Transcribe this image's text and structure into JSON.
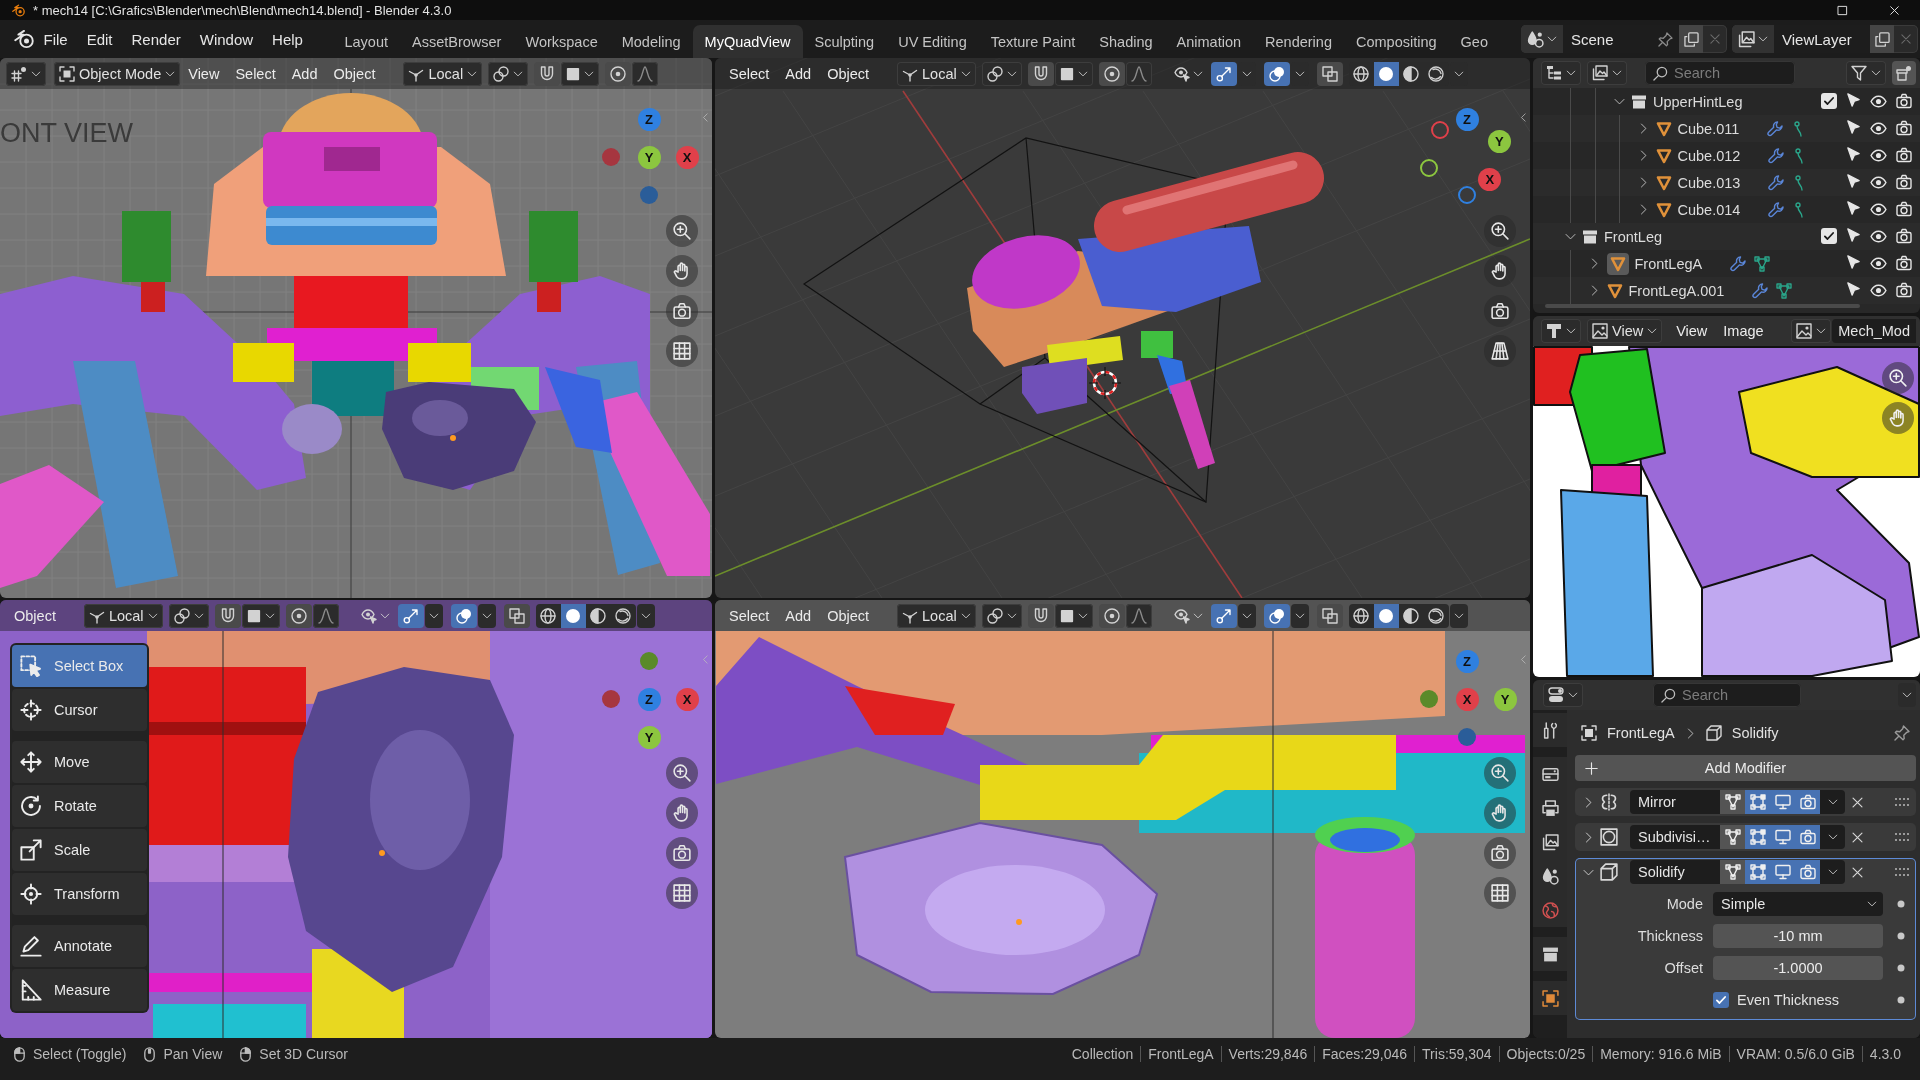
{
  "window": {
    "title": "* mech14 [C:\\Grafics\\Blender\\mech\\Blend\\mech14.blend] - Blender 4.3.0"
  },
  "menu_bar": {
    "menus": [
      "File",
      "Edit",
      "Render",
      "Window",
      "Help"
    ],
    "workspaces": [
      {
        "label": "Layout",
        "selected": false
      },
      {
        "label": "AssetBrowser",
        "selected": false
      },
      {
        "label": "Workspace",
        "selected": false
      },
      {
        "label": "Modeling",
        "selected": false
      },
      {
        "label": "MyQuadView",
        "selected": true
      },
      {
        "label": "Sculpting",
        "selected": false
      },
      {
        "label": "UV Editing",
        "selected": false
      },
      {
        "label": "Texture Paint",
        "selected": false
      },
      {
        "label": "Shading",
        "selected": false
      },
      {
        "label": "Animation",
        "selected": false
      },
      {
        "label": "Rendering",
        "selected": false
      },
      {
        "label": "Compositing",
        "selected": false
      },
      {
        "label": "Geo",
        "selected": false
      }
    ],
    "scene": "Scene",
    "view_layer": "ViewLayer"
  },
  "viewports": [
    {
      "header": [
        {
          "kind": "editor_type"
        },
        {
          "kind": "mode",
          "label": "Object Mode"
        },
        {
          "kind": "menu",
          "label": "View"
        },
        {
          "kind": "menu",
          "label": "Select"
        },
        {
          "kind": "menu",
          "label": "Add"
        },
        {
          "kind": "menu",
          "label": "Object"
        },
        {
          "kind": "orientation",
          "label": "Local"
        },
        {
          "kind": "pivot"
        },
        {
          "kind": "snap",
          "on": false
        },
        {
          "kind": "snap_target"
        },
        {
          "kind": "proportional",
          "on": false
        },
        {
          "kind": "falloff"
        }
      ],
      "overlay_text": "ONT VIEW",
      "perspective": false,
      "gizmo": [
        {
          "kind": "ball",
          "color": "#a6363f"
        },
        {
          "kind": "ball",
          "color": "#2a5d99"
        },
        {
          "kind": "ball",
          "label": "Z",
          "color": "#2f80e0"
        },
        {
          "kind": "ball",
          "label": "X",
          "color": "#e0404a"
        },
        {
          "kind": "ball",
          "label": "Y",
          "color": "#8cc63f"
        }
      ]
    },
    {
      "header": [
        {
          "kind": "menu",
          "label": "Select"
        },
        {
          "kind": "menu",
          "label": "Add"
        },
        {
          "kind": "menu",
          "label": "Object"
        },
        {
          "kind": "orientation",
          "label": "Local"
        },
        {
          "kind": "pivot"
        },
        {
          "kind": "snap",
          "on": false
        },
        {
          "kind": "snap_target"
        },
        {
          "kind": "proportional",
          "on": false
        },
        {
          "kind": "falloff"
        },
        {
          "kind": "visibility"
        },
        {
          "kind": "gizmos",
          "on": true
        },
        {
          "kind": "overlays",
          "on": true
        },
        {
          "kind": "xray",
          "on": false
        },
        {
          "kind": "shading",
          "modes": [
            {
              "selected": false
            },
            {
              "selected": true
            },
            {
              "selected": false
            },
            {
              "selected": false
            }
          ]
        }
      ],
      "perspective": true,
      "gizmo": [
        {
          "kind": "ring",
          "color": "#e0404a"
        },
        {
          "kind": "ring",
          "color": "#8cc63f"
        },
        {
          "kind": "ring",
          "color": "#2f80e0"
        },
        {
          "kind": "ball",
          "label": "Z",
          "color": "#2f80e0"
        },
        {
          "kind": "ball",
          "label": "Y",
          "color": "#8cc63f"
        },
        {
          "kind": "ball",
          "label": "X",
          "color": "#e0404a"
        }
      ]
    },
    {
      "header": [
        {
          "kind": "menu",
          "label": "Object"
        },
        {
          "kind": "orientation",
          "label": "Local"
        },
        {
          "kind": "pivot"
        },
        {
          "kind": "snap",
          "on": false
        },
        {
          "kind": "snap_target"
        },
        {
          "kind": "proportional",
          "on": false
        },
        {
          "kind": "falloff"
        },
        {
          "kind": "visibility"
        },
        {
          "kind": "gizmos",
          "on": true
        },
        {
          "kind": "overlays",
          "on": true
        },
        {
          "kind": "xray",
          "on": false
        },
        {
          "kind": "shading",
          "modes": [
            {
              "selected": false
            },
            {
              "selected": true
            },
            {
              "selected": false
            },
            {
              "selected": false
            }
          ]
        }
      ],
      "perspective": false,
      "gizmo": [
        {
          "kind": "ball",
          "color": "#5a8a2a"
        },
        {
          "kind": "ball",
          "color": "#a6363f"
        },
        {
          "kind": "ball",
          "label": "X",
          "color": "#e0404a"
        },
        {
          "kind": "ball",
          "label": "Y",
          "color": "#8cc63f"
        },
        {
          "kind": "ball",
          "label": "Z",
          "color": "#2f80e0"
        }
      ],
      "toolbar": [
        {
          "tools": [
            {
              "label": "Select Box",
              "selected": true
            },
            {
              "label": "Cursor",
              "selected": false
            }
          ]
        },
        {
          "tools": [
            {
              "label": "Move",
              "selected": false
            },
            {
              "label": "Rotate",
              "selected": false
            },
            {
              "label": "Scale",
              "selected": false
            },
            {
              "label": "Transform",
              "selected": false
            }
          ]
        },
        {
          "tools": [
            {
              "label": "Annotate",
              "selected": false
            },
            {
              "label": "Measure",
              "selected": false
            }
          ]
        }
      ]
    },
    {
      "header": [
        {
          "kind": "menu",
          "label": "Select"
        },
        {
          "kind": "menu",
          "label": "Add"
        },
        {
          "kind": "menu",
          "label": "Object"
        },
        {
          "kind": "orientation",
          "label": "Local"
        },
        {
          "kind": "pivot"
        },
        {
          "kind": "snap",
          "on": false
        },
        {
          "kind": "snap_target"
        },
        {
          "kind": "proportional",
          "on": false
        },
        {
          "kind": "falloff"
        },
        {
          "kind": "visibility"
        },
        {
          "kind": "gizmos",
          "on": true
        },
        {
          "kind": "overlays",
          "on": true
        },
        {
          "kind": "xray",
          "on": false
        },
        {
          "kind": "shading",
          "modes": [
            {
              "selected": false
            },
            {
              "selected": true
            },
            {
              "selected": false
            },
            {
              "selected": false
            }
          ]
        }
      ],
      "perspective": false,
      "gizmo": [
        {
          "kind": "ball",
          "color": "#5a8a2a"
        },
        {
          "kind": "ball",
          "color": "#2a5d99"
        },
        {
          "kind": "ball",
          "label": "Z",
          "color": "#2f80e0"
        },
        {
          "kind": "ball",
          "label": "Y",
          "color": "#8cc63f"
        },
        {
          "kind": "ball",
          "label": "X",
          "color": "#e0404a"
        }
      ]
    }
  ],
  "outliner": {
    "search": {
      "placeholder": "Search"
    },
    "tree": [
      {
        "children": [
          {
            "children": [
              {
                "kind": "collection",
                "label": "UpperHintLeg",
                "expanded": true,
                "selected": false,
                "checked": true,
                "selectable": true,
                "visible": true,
                "renderable": true,
                "children": [
                  {
                    "kind": "object",
                    "label": "Cube.011",
                    "expanded": false,
                    "selected": false,
                    "modifiers": true,
                    "mesh_data": false,
                    "hook_data": true,
                    "selectable": true,
                    "visible": true,
                    "renderable": true
                  },
                  {
                    "kind": "object",
                    "label": "Cube.012",
                    "expanded": false,
                    "selected": false,
                    "modifiers": true,
                    "mesh_data": false,
                    "hook_data": true,
                    "selectable": true,
                    "visible": true,
                    "renderable": true
                  },
                  {
                    "kind": "object",
                    "label": "Cube.013",
                    "expanded": false,
                    "selected": false,
                    "modifiers": true,
                    "mesh_data": false,
                    "hook_data": true,
                    "selectable": true,
                    "visible": true,
                    "renderable": true
                  },
                  {
                    "kind": "object",
                    "label": "Cube.014",
                    "expanded": false,
                    "selected": false,
                    "modifiers": true,
                    "mesh_data": false,
                    "hook_data": true,
                    "selectable": true,
                    "visible": true,
                    "renderable": true
                  }
                ]
              }
            ]
          }
        ]
      },
      {
        "kind": "collection",
        "label": "FrontLeg",
        "expanded": true,
        "selected": false,
        "checked": true,
        "selectable": true,
        "visible": true,
        "renderable": true,
        "children": [
          {
            "kind": "object",
            "label": "FrontLegA",
            "expanded": false,
            "selected": true,
            "modifiers": true,
            "mesh_data": true,
            "hook_data": false,
            "selectable": true,
            "visible": true,
            "renderable": true
          },
          {
            "kind": "object",
            "label": "FrontLegA.001",
            "expanded": false,
            "selected": false,
            "modifiers": true,
            "mesh_data": true,
            "hook_data": false,
            "selectable": true,
            "visible": true,
            "renderable": true
          }
        ]
      }
    ]
  },
  "image_editor": {
    "header": {
      "mode": "View",
      "menus": [
        "View",
        "Image"
      ],
      "image": "Mech_Mod"
    }
  },
  "properties": {
    "search": {
      "placeholder": "Search"
    },
    "tabs": [
      {
        "selected": false
      },
      {
        "selected": false
      },
      {
        "selected": false
      },
      {
        "selected": false
      },
      {
        "selected": false
      },
      {
        "selected": false
      },
      {
        "selected": false
      },
      {
        "selected": false
      }
    ],
    "breadcrumb": [
      "FrontLegA",
      "Solidify"
    ],
    "add_button": "Add Modifier",
    "modifiers": [
      {
        "kind": "mirror",
        "name": "Mirror",
        "expanded": false,
        "active": false,
        "toggles": [
          {
            "on": false
          },
          {
            "on": true
          },
          {
            "on": true
          },
          {
            "on": true
          }
        ]
      },
      {
        "kind": "subdivision",
        "name": "Subdivisi…",
        "expanded": false,
        "active": false,
        "toggles": [
          {
            "on": false
          },
          {
            "on": true
          },
          {
            "on": true
          },
          {
            "on": true
          }
        ]
      },
      {
        "kind": "solidify",
        "name": "Solidify",
        "expanded": true,
        "active": true,
        "toggles": [
          {
            "on": false
          },
          {
            "on": true
          },
          {
            "on": true
          },
          {
            "on": true
          }
        ],
        "settings": [
          {
            "kind": "dropdown",
            "label": "Mode",
            "value": "Simple"
          },
          {
            "kind": "number",
            "label": "Thickness",
            "value": "-10 mm"
          },
          {
            "kind": "number",
            "label": "Offset",
            "value": "-1.0000"
          },
          {
            "kind": "checkbox",
            "label": "Even Thickness",
            "checked": true
          }
        ]
      }
    ]
  },
  "status_bar": {
    "hints": [
      "Select (Toggle)",
      "Pan View",
      "Set 3D Cursor"
    ],
    "stats": [
      "Collection",
      "FrontLegA",
      "Verts:29,846",
      "Faces:29,046",
      "Tris:59,304",
      "Objects:0/25",
      "Memory: 916.6 MiB",
      "VRAM: 0.5/6.0 GiB",
      "4.3.0"
    ]
  }
}
